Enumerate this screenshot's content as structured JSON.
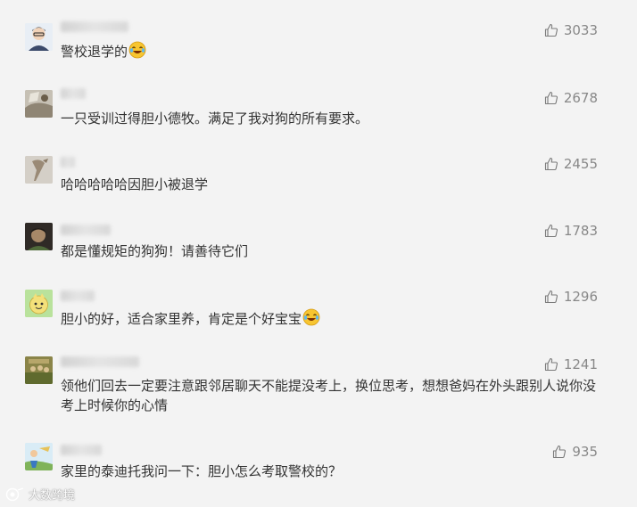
{
  "comments": [
    {
      "text": "警校退学的",
      "likes": "3033",
      "emoji": "laughing-tears"
    },
    {
      "text": "一只受训过得胆小德牧。满足了我对狗的所有要求。",
      "likes": "2678"
    },
    {
      "text": "哈哈哈哈哈因胆小被退学",
      "likes": "2455"
    },
    {
      "text": "都是懂规矩的狗狗！请善待它们",
      "likes": "1783"
    },
    {
      "text": "胆小的好，适合家里养，肯定是个好宝宝",
      "likes": "1296",
      "emoji": "laughing-tears"
    },
    {
      "text": "领他们回去一定要注意跟邻居聊天不能提没考上，换位思考，想想爸妈在外头跟别人说你没考上时候你的心情",
      "likes": "1241"
    },
    {
      "text": "家里的泰迪托我问一下：胆小怎么考取警校的？",
      "likes": "935"
    }
  ],
  "watermark": {
    "text": "大数跨境"
  },
  "colors": {
    "background": "#f3f3f3",
    "text": "#333333",
    "like": "#888888"
  },
  "icons": {
    "like": "thumbs-up-icon"
  }
}
